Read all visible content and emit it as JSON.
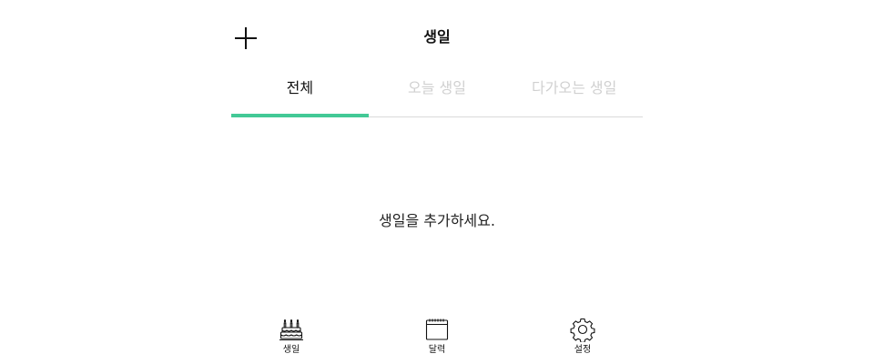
{
  "header": {
    "title": "생일",
    "add_icon": "plus-icon"
  },
  "tabs": [
    {
      "label": "전체",
      "active": true
    },
    {
      "label": "오늘 생일",
      "active": false
    },
    {
      "label": "다가오는 생일",
      "active": false
    }
  ],
  "empty_state": {
    "message": "생일을 추가하세요."
  },
  "bottom_nav": [
    {
      "label": "생일",
      "icon": "birthday-cake-icon"
    },
    {
      "label": "달력",
      "icon": "calendar-icon"
    },
    {
      "label": "설정",
      "icon": "gear-icon"
    }
  ],
  "colors": {
    "accent": "#43c996",
    "inactive_tab": "#d0d0d0",
    "divider": "#d9d9d9"
  }
}
